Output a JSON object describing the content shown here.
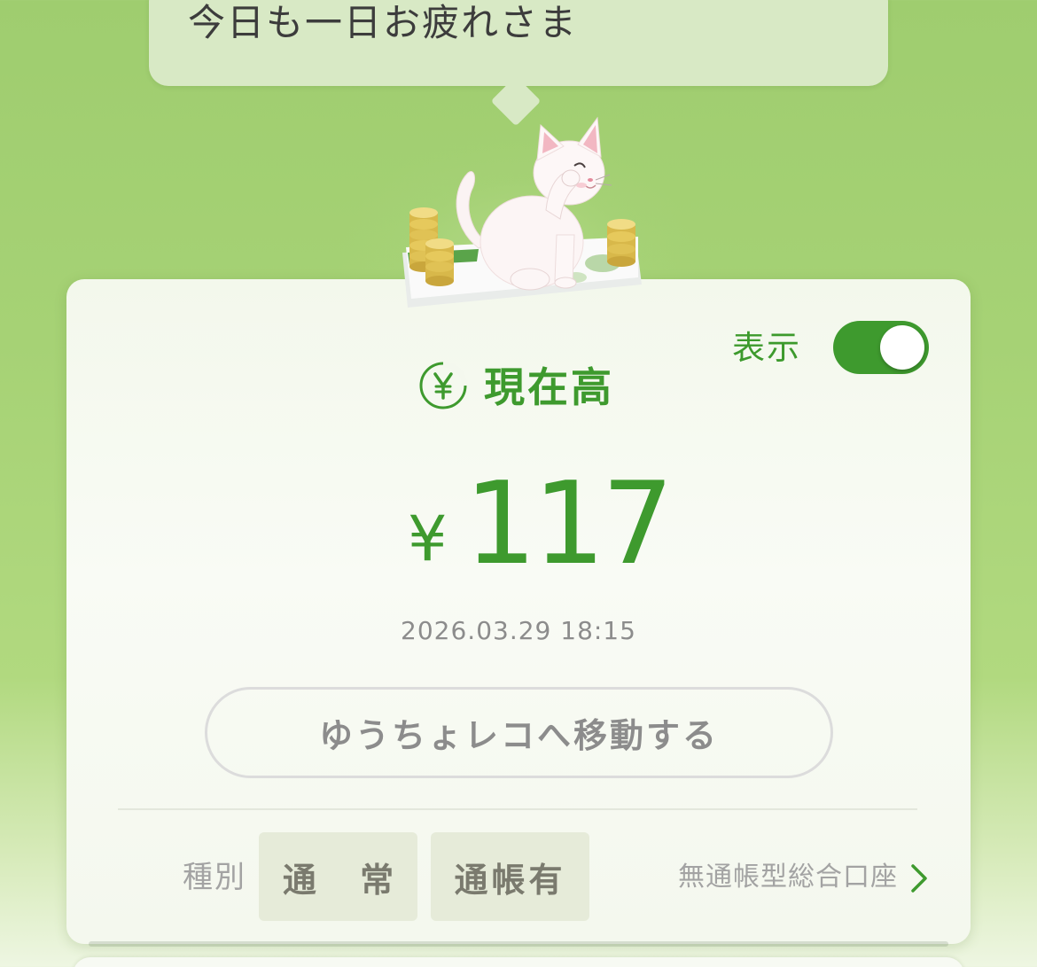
{
  "greeting": "今日も一日お疲れさま",
  "display_toggle": {
    "label": "表示",
    "on": true
  },
  "balance": {
    "title": "現在高",
    "currency_symbol": "¥",
    "amount": "117",
    "timestamp": "2026.03.29 18:15"
  },
  "move_button_label": "ゆうちょレコへ移動する",
  "account": {
    "type_label": "種別",
    "tags": [
      "通 常",
      "通帳有"
    ],
    "link_label": "無通帳型総合口座"
  },
  "icons": {
    "yen_coin": "yen-circle-icon",
    "chevron": "chevron-right-icon",
    "mascot": "cat-mascot"
  },
  "colors": {
    "accent_green": "#3e9a2e",
    "background_green": "#a6d275",
    "toggle_on": "#3e9a2e"
  }
}
